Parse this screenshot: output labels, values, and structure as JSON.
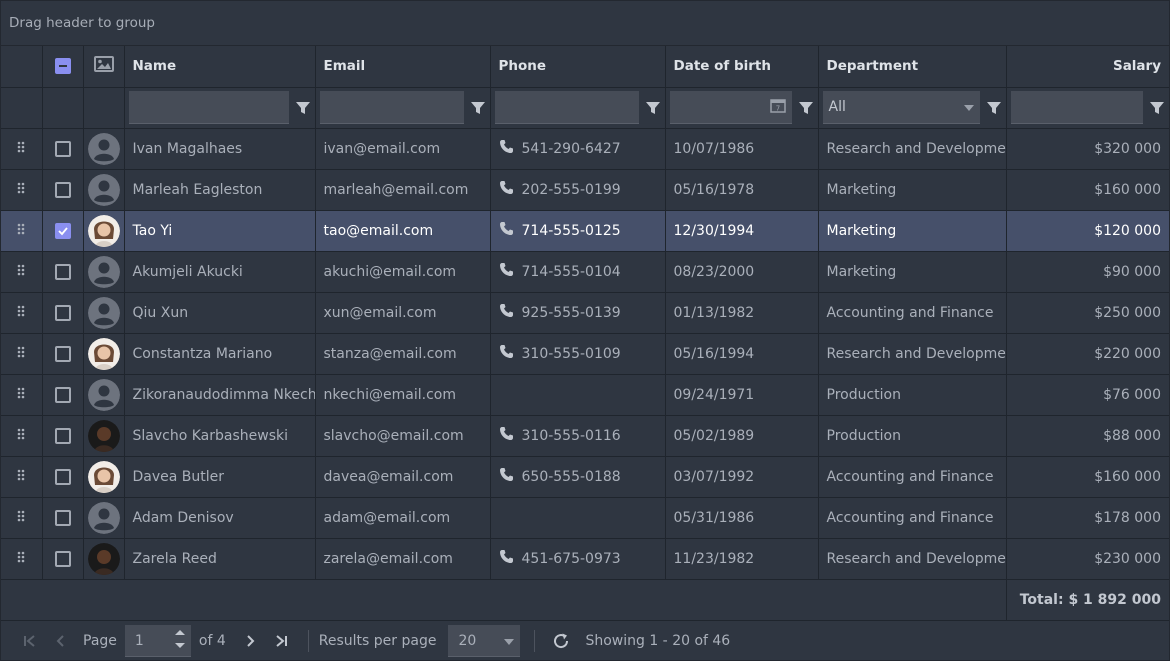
{
  "grid": {
    "group_panel_text": "Drag header to group",
    "columns": {
      "name": "Name",
      "email": "Email",
      "phone": "Phone",
      "dob": "Date of birth",
      "department": "Department",
      "salary": "Salary"
    },
    "filters": {
      "department_value": "All"
    },
    "rows": [
      {
        "name": "Ivan Magalhaes",
        "email": "ivan@email.com",
        "phone": "541-290-6427",
        "dob": "10/07/1986",
        "department": "Research and Development",
        "salary": "$320 000",
        "avatar": "placeholder",
        "selected": false
      },
      {
        "name": "Marleah Eagleston",
        "email": "marleah@email.com",
        "phone": "202-555-0199",
        "dob": "05/16/1978",
        "department": "Marketing",
        "salary": "$160 000",
        "avatar": "placeholder",
        "selected": false
      },
      {
        "name": "Tao Yi",
        "email": "tao@email.com",
        "phone": "714-555-0125",
        "dob": "12/30/1994",
        "department": "Marketing",
        "salary": "$120 000",
        "avatar": "photo-light",
        "selected": true
      },
      {
        "name": "Akumjeli Akucki",
        "email": "akuchi@email.com",
        "phone": "714-555-0104",
        "dob": "08/23/2000",
        "department": "Marketing",
        "salary": "$90 000",
        "avatar": "placeholder",
        "selected": false
      },
      {
        "name": "Qiu Xun",
        "email": "xun@email.com",
        "phone": "925-555-0139",
        "dob": "01/13/1982",
        "department": "Accounting and Finance",
        "salary": "$250 000",
        "avatar": "placeholder",
        "selected": false
      },
      {
        "name": "Constantza Mariano",
        "email": "stanza@email.com",
        "phone": "310-555-0109",
        "dob": "05/16/1994",
        "department": "Research and Development",
        "salary": "$220 000",
        "avatar": "photo-light",
        "selected": false
      },
      {
        "name": "Zikoranaudodimma Nkechi",
        "email": "nkechi@email.com",
        "phone": "",
        "dob": "09/24/1971",
        "department": "Production",
        "salary": "$76 000",
        "avatar": "placeholder",
        "selected": false
      },
      {
        "name": "Slavcho Karbashewski",
        "email": "slavcho@email.com",
        "phone": "310-555-0116",
        "dob": "05/02/1989",
        "department": "Production",
        "salary": "$88 000",
        "avatar": "photo-dark",
        "selected": false
      },
      {
        "name": "Davea Butler",
        "email": "davea@email.com",
        "phone": "650-555-0188",
        "dob": "03/07/1992",
        "department": "Accounting and Finance",
        "salary": "$160 000",
        "avatar": "photo-light",
        "selected": false
      },
      {
        "name": "Adam Denisov",
        "email": "adam@email.com",
        "phone": "",
        "dob": "05/31/1986",
        "department": "Accounting and Finance",
        "salary": "$178 000",
        "avatar": "placeholder",
        "selected": false
      },
      {
        "name": "Zarela Reed",
        "email": "zarela@email.com",
        "phone": "451-675-0973",
        "dob": "11/23/1982",
        "department": "Research and Development",
        "salary": "$230 000",
        "avatar": "photo-dark",
        "selected": false
      }
    ],
    "summary": {
      "total": "Total: $ 1 892 000"
    }
  },
  "pager": {
    "page_label": "Page",
    "page_value": "1",
    "of_label": "of 4",
    "results_label": "Results per page",
    "per_page_value": "20",
    "showing_text": "Showing 1 - 20 of 46"
  },
  "colors": {
    "background": "#2f3641",
    "selected_row": "#46506a",
    "accent": "#8a8ff0"
  }
}
